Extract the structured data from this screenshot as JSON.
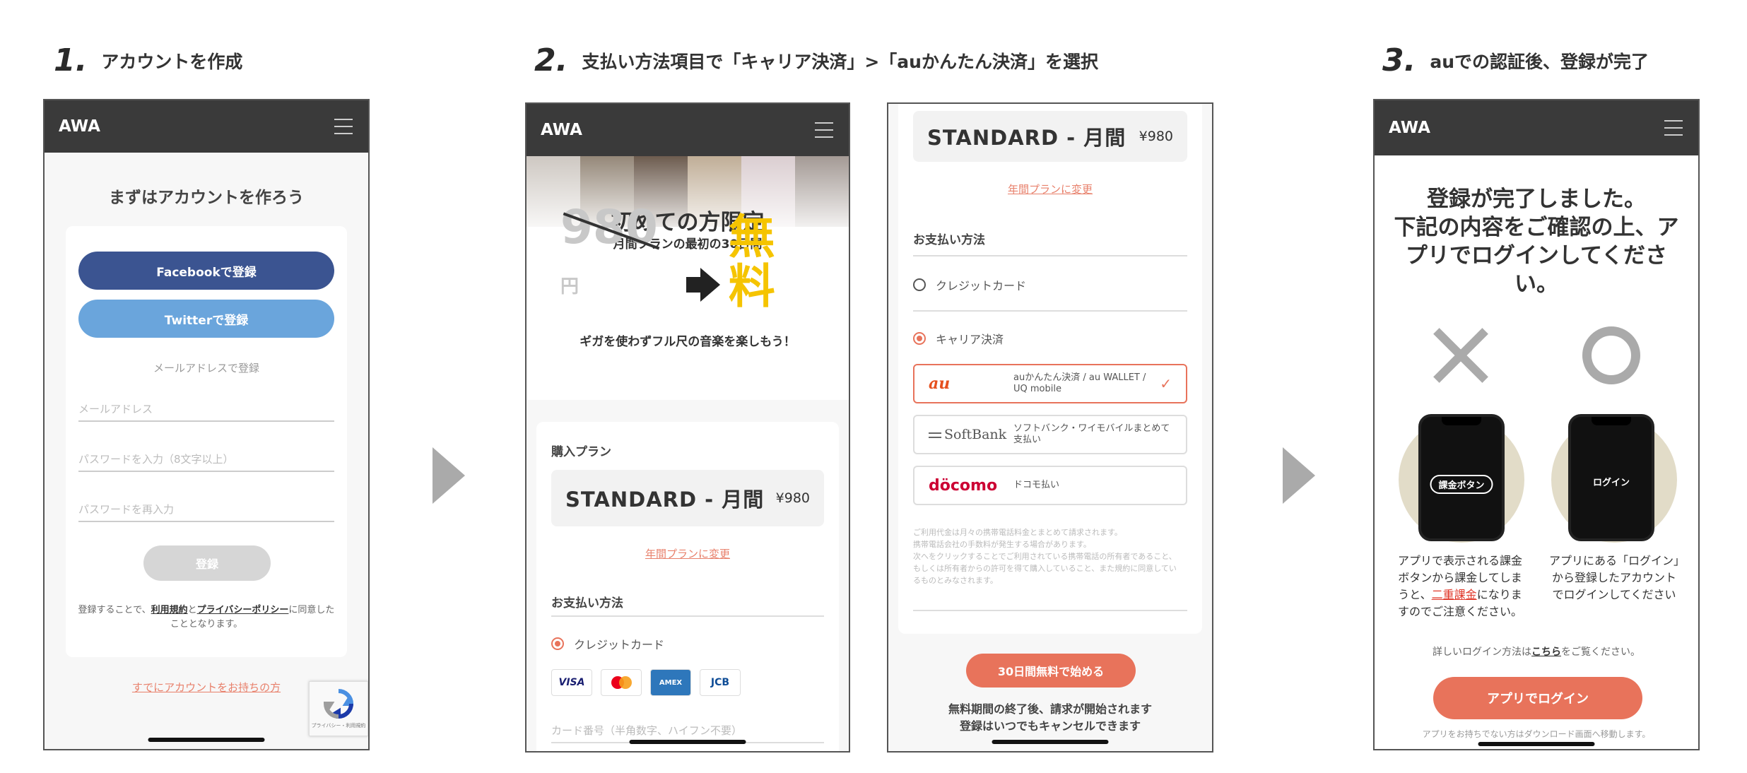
{
  "steps": [
    {
      "num": "1.",
      "title": "アカウントを作成"
    },
    {
      "num": "2.",
      "title": "支払い方法項目で「キャリア決済」>「auかんたん決済」を選択"
    },
    {
      "num": "3.",
      "title": "auでの認証後、登録が完了"
    }
  ],
  "app": {
    "logo": "AWA"
  },
  "signup": {
    "title": "まずはアカウントを作ろう",
    "facebook_label": "Facebookで登録",
    "twitter_label": "Twitterで登録",
    "email_divider": "メールアドレスで登録",
    "email_placeholder": "メールアドレス",
    "password_placeholder": "パスワードを入力（8文字以上）",
    "password_confirm_placeholder": "パスワードを再入力",
    "register_label": "登録",
    "terms_pre": "登録することで、",
    "terms_link": "利用規約",
    "terms_mid": "と",
    "privacy_link": "プライバシーポリシー",
    "terms_post": "に同意したこととなります。",
    "existing_account_link": "すでにアカウントをお持ちの方",
    "recaptcha_text": "プライバシー・利用規約"
  },
  "promo": {
    "headline": "初めての方限定",
    "sub": "月間プランの最初の30日間",
    "old_price": "980",
    "yen": "円",
    "free": "無料",
    "tagline": "ギガを使わずフル尺の音楽を楽しもう！"
  },
  "purchase": {
    "plan_label": "購入プラン",
    "plan_name": "STANDARD - 月間",
    "plan_price": "¥980",
    "change_plan_link": "年間プランに変更",
    "payment_label": "お支払い方法",
    "credit_card": "クレジットカード",
    "card_brands": [
      "VISA",
      "●●",
      "AMEX",
      "JCB"
    ],
    "card_number_placeholder": "カード番号（半角数字、ハイフン不要）"
  },
  "carrier": {
    "plan_name": "STANDARD - 月間",
    "plan_price": "¥980",
    "change_plan_link": "年間プランに変更",
    "payment_label": "お支払い方法",
    "credit_card": "クレジットカード",
    "carrier_payment": "キャリア決済",
    "options": [
      {
        "name": "au",
        "desc": "auかんたん決済 / au WALLET / UQ mobile",
        "color": "#e6501e"
      },
      {
        "name": "SoftBank",
        "desc": "ソフトバンク・ワイモバイルまとめて支払い",
        "color": "#555555"
      },
      {
        "name": "döcomo",
        "desc": "ドコモ払い",
        "color": "#cc0033"
      }
    ],
    "fine_print": [
      "ご利用代金は月々の携帯電話料金とまとめて請求されます。",
      "携帯電話会社の手数料が発生する場合があります。",
      "次へをクリックすることでご利用されている携帯電話の所有者であること、",
      "もしくは所有者からの許可を得て購入していること、また規約に同意してい",
      "るものとみなされます。"
    ],
    "start_button": "30日間無料で始める",
    "note_line1": "無料期間の終了後、請求が開始されます",
    "note_line2": "登録はいつでもキャンセルできます"
  },
  "complete": {
    "title_lines": [
      "登録が完了しました。",
      "下記の内容をご確認の上、ア",
      "プリでログインしてくださ",
      "い。"
    ],
    "wrong_mark": "✕",
    "right_mark": "○",
    "wrong_device_label": "課金ボタン",
    "right_device_label": "ログイン",
    "wrong_text_1": "アプリで表示される課金ボタンから課金してしまうと、",
    "wrong_text_red": "二重課金",
    "wrong_text_2": "になりますのでご注意ください。",
    "right_text": "アプリにある「ログイン」から登録したアカウントでログインしてください",
    "details_pre": "詳しいログイン方法は",
    "details_link": "こちら",
    "details_post": "をご覧ください。",
    "login_button": "アプリでログイン",
    "footer_note": "アプリをお持ちでない方はダウンロード画面へ移動します。"
  },
  "colors": {
    "accent": "#e8735b",
    "header": "#3a3a3a",
    "facebook": "#3b5491",
    "twitter": "#6aa5dc",
    "free_yellow": "#f5c400"
  }
}
